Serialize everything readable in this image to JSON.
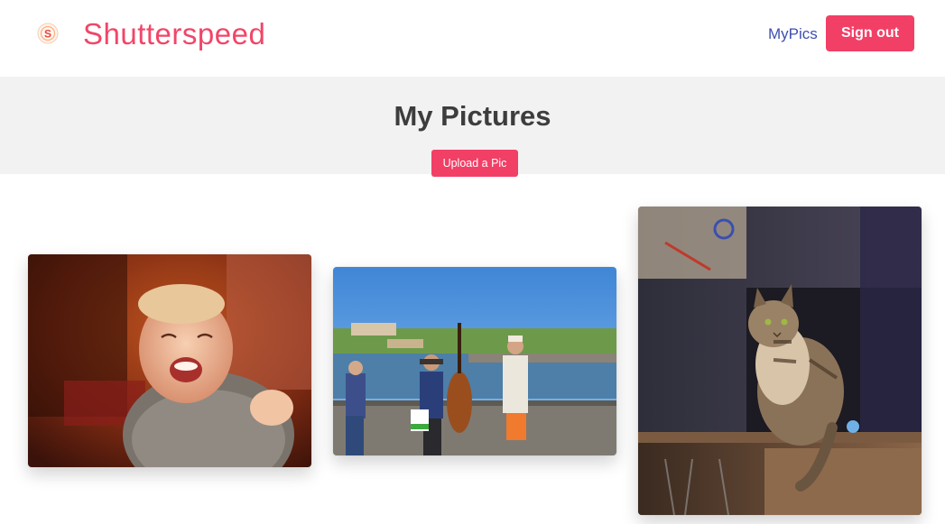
{
  "nav": {
    "brand": "Shutterspeed",
    "logo_icon": "shutter-logo-icon",
    "my_pics_link": "MyPics",
    "sign_out_label": "Sign out"
  },
  "hero": {
    "title": "My Pictures",
    "upload_label": "Upload a Pic"
  },
  "pictures": [
    {
      "subject": "laughing-toddler-photo"
    },
    {
      "subject": "street-musicians-bridge-photo"
    },
    {
      "subject": "tabby-cat-on-cabinet-photo"
    }
  ],
  "colors": {
    "accent": "#f23f66",
    "brand_text": "#f14668",
    "link": "#3e4fb0",
    "hero_bg": "#f2f2f2"
  }
}
